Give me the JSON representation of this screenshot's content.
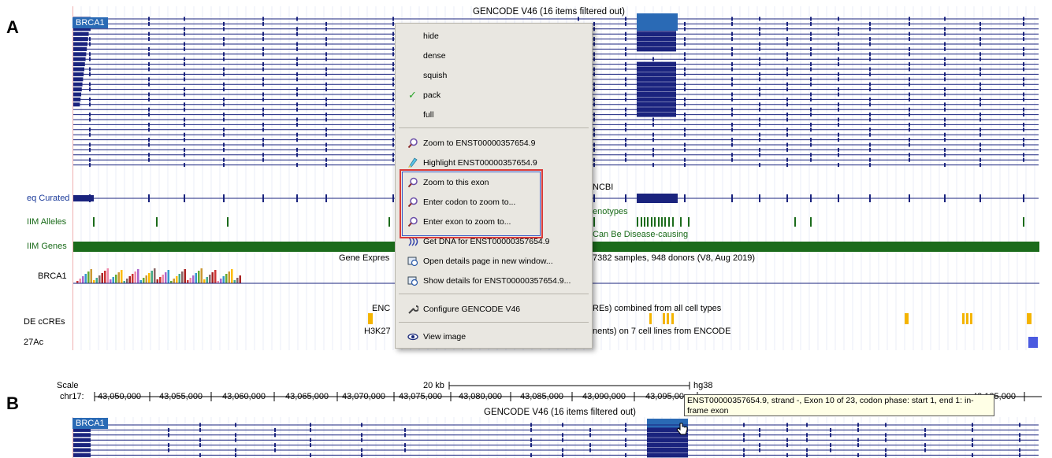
{
  "panels": {
    "a": "A",
    "b": "B"
  },
  "panel_a": {
    "track_header": "GENCODE V46 (16 items filtered out)",
    "gene_pill": "BRCA1",
    "labels": {
      "refseq": "eq Curated",
      "refseq_right": "NCBI",
      "omim_alleles": "IIM Alleles",
      "omim_alleles_right": "enotypes",
      "omim_genes": "IIM Genes",
      "omim_genes_right": "Can Be Disease-causing",
      "gtex_left": "Gene Expres",
      "gtex_right": "7382 samples, 948 donors (V8, Aug 2019)",
      "gtex_gene": "BRCA1",
      "encode_left": "ENC",
      "encode_right": "REs) combined from all cell types",
      "ccre": "DE cCREs",
      "h3k_left": "H3K27",
      "h3k_right": "nents) on 7 cell lines from ENCODE",
      "h3k_track": "27Ac"
    }
  },
  "menu": {
    "display_modes": [
      {
        "label": "hide",
        "checked": false
      },
      {
        "label": "dense",
        "checked": false
      },
      {
        "label": "squish",
        "checked": false
      },
      {
        "label": "pack",
        "checked": true
      },
      {
        "label": "full",
        "checked": false
      }
    ],
    "checkmark": "✓",
    "items": {
      "zoom_transcript": "Zoom to ENST00000357654.9",
      "highlight": "Highlight ENST00000357654.9",
      "zoom_exon": "Zoom to this exon",
      "enter_codon": "Enter codon to zoom to...",
      "enter_exon": "Enter exon to zoom to...",
      "get_dna": "Get DNA for ENST00000357654.9",
      "open_details": "Open details page in new window...",
      "show_details": "Show details for ENST00000357654.9...",
      "configure": "Configure GENCODE V46",
      "view_image": "View image"
    },
    "icons": {
      "zoom": "magnifier-icon",
      "highlight": "highlighter-icon",
      "dna": "dna-icon",
      "window": "new-window-icon",
      "details": "details-icon",
      "wrench": "wrench-icon",
      "eye": "eye-icon"
    }
  },
  "panel_b": {
    "scale_label": "Scale",
    "scale_value": "20 kb",
    "assembly": "hg38",
    "chrom_label": "chr17:",
    "ticks": [
      "43,050,000",
      "43,055,000",
      "43,060,000",
      "43,065,000",
      "43,070,000",
      "43,075,000",
      "43,080,000",
      "43,085,000",
      "43,090,000",
      "43,095,00",
      "43,125,000"
    ],
    "track_header": "GENCODE V46 (16 items filtered out)",
    "gene_pill": "BRCA1",
    "tooltip": "ENST00000357654.9, strand -, Exon 10 of 23, codon phase: start 1, end 1: in-frame exon"
  },
  "colors": {
    "gene": "#1a237e",
    "omim": "#1b6b1b",
    "accent": "#2a6ab5",
    "highlight_red": "#d83a3a",
    "ccre_yellow": "#f4b400"
  }
}
